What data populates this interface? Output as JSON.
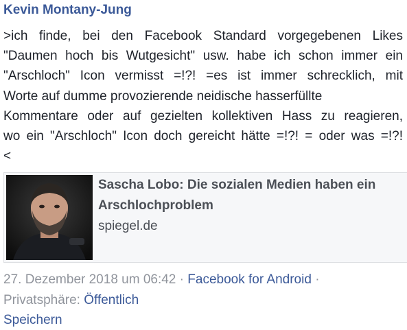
{
  "post": {
    "author": "Kevin Montany-Jung",
    "text_lines": [
      ">ich finde, bei den Facebook Standard vorgegebenen Likes",
      "\"Daumen hoch bis Wutgesicht\" usw. habe ich schon immer ein",
      "\"Arschloch\" Icon vermisst =!?! =es ist immer schrecklich, mit",
      "Worte auf dumme provozierende neidische hasserfüllte",
      "Kommentare oder auf gezielten kollektiven Hass zu reagieren,",
      "wo ein \"Arschloch\" Icon doch gereicht hätte =!?! = oder was =!?!",
      "<"
    ],
    "link": {
      "title": "Sascha Lobo: Die sozialen Medien haben ein Arschlochproblem",
      "domain": "spiegel.de",
      "thumbnail": "portrait-photo"
    },
    "meta": {
      "date": "27. Dezember 2018 um 06:42",
      "separator": "·",
      "app": "Facebook for Android",
      "privacy_label": "Privatsphäre:",
      "privacy_value": "Öffentlich"
    },
    "save_label": "Speichern"
  },
  "colors": {
    "link": "#3b5998",
    "text": "#1d2129",
    "muted": "#90949c",
    "card_bg": "#f6f7f9"
  }
}
